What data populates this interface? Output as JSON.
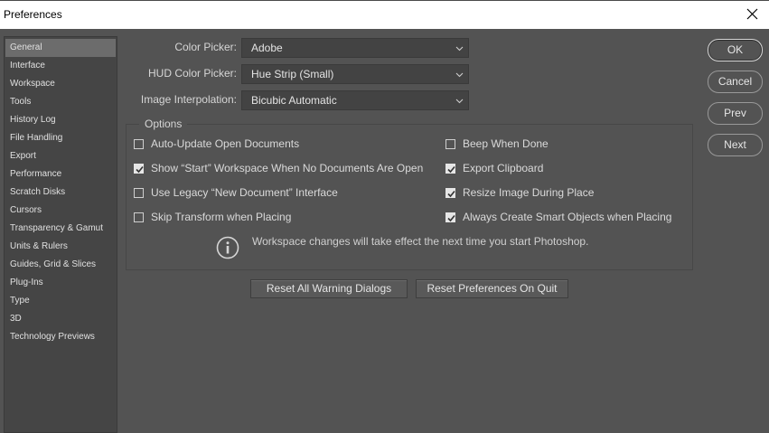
{
  "window": {
    "title": "Preferences"
  },
  "sidebar": {
    "items": [
      {
        "label": "General",
        "selected": true
      },
      {
        "label": "Interface"
      },
      {
        "label": "Workspace"
      },
      {
        "label": "Tools"
      },
      {
        "label": "History Log"
      },
      {
        "label": "File Handling"
      },
      {
        "label": "Export"
      },
      {
        "label": "Performance"
      },
      {
        "label": "Scratch Disks"
      },
      {
        "label": "Cursors"
      },
      {
        "label": "Transparency & Gamut"
      },
      {
        "label": "Units & Rulers"
      },
      {
        "label": "Guides, Grid & Slices"
      },
      {
        "label": "Plug-Ins"
      },
      {
        "label": "Type"
      },
      {
        "label": "3D"
      },
      {
        "label": "Technology Previews"
      }
    ]
  },
  "fields": {
    "color_picker": {
      "label": "Color Picker:",
      "value": "Adobe"
    },
    "hud_color_picker": {
      "label": "HUD Color Picker:",
      "value": "Hue Strip (Small)"
    },
    "image_interpolation": {
      "label": "Image Interpolation:",
      "value": "Bicubic Automatic"
    }
  },
  "options": {
    "legend": "Options",
    "left": [
      {
        "label": "Auto-Update Open Documents",
        "checked": false
      },
      {
        "label": "Show “Start” Workspace When No Documents Are Open",
        "checked": true
      },
      {
        "label": "Use Legacy “New Document” Interface",
        "checked": false
      },
      {
        "label": "Skip Transform when Placing",
        "checked": false
      }
    ],
    "right": [
      {
        "label": "Beep When Done",
        "checked": false
      },
      {
        "label": "Export Clipboard",
        "checked": true
      },
      {
        "label": "Resize Image During Place",
        "checked": true
      },
      {
        "label": "Always Create Smart Objects when Placing",
        "checked": true
      }
    ],
    "info": "Workspace changes will take effect the next time you start Photoshop."
  },
  "buttons": {
    "reset_warnings": "Reset All Warning Dialogs",
    "reset_prefs": "Reset Preferences On Quit",
    "ok": "OK",
    "cancel": "Cancel",
    "prev": "Prev",
    "next": "Next"
  },
  "colors": {
    "background": "#535353",
    "sidebar": "#454545",
    "selected": "#6c6c6c",
    "titlebar": "#ffffff"
  },
  "icons": {
    "close": "close-icon",
    "dropdown": "chevron-down-icon",
    "checkmark": "checkmark-icon",
    "info": "info-icon"
  }
}
